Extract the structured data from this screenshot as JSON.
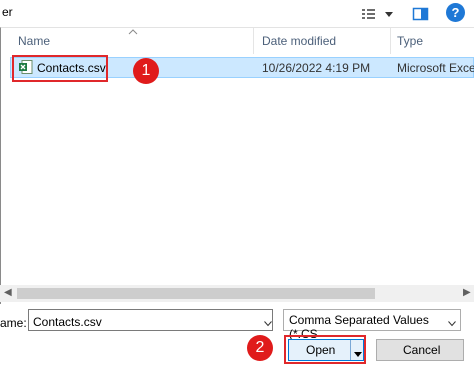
{
  "toolbar": {
    "title_fragment": "er",
    "help_label": "?"
  },
  "columns": {
    "name": "Name",
    "date_modified": "Date modified",
    "type": "Type"
  },
  "files": [
    {
      "name": "Contacts.csv",
      "date": "10/26/2022 4:19 PM",
      "type": "Microsoft Excel",
      "selected": true,
      "icon": "excel-csv-icon"
    }
  ],
  "footer": {
    "name_label": "ame:",
    "name_value": "Contacts.csv",
    "type_value": "Comma Separated Values (*.CS",
    "open_label": "Open",
    "cancel_label": "Cancel"
  },
  "annotations": {
    "step1": "1",
    "step2": "2"
  },
  "colors": {
    "highlight": "#e0282b",
    "selection": "#cce8ff",
    "accent": "#0078d7"
  }
}
